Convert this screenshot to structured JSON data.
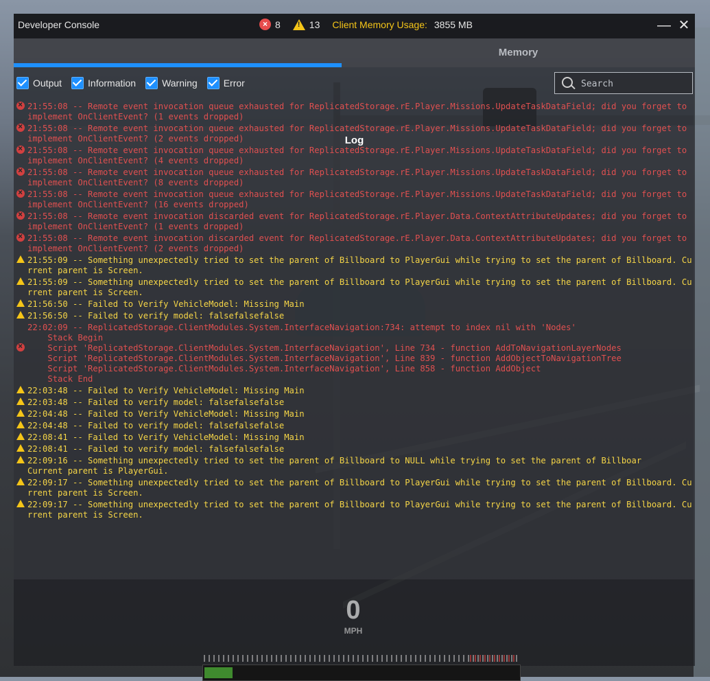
{
  "window": {
    "title": "Developer Console",
    "error_count": "8",
    "warning_count": "13",
    "memory_label": "Client Memory Usage:",
    "memory_value": "3855 MB",
    "minimize_glyph": "—",
    "close_glyph": "✕"
  },
  "tabs": [
    {
      "label": "Log",
      "active": true
    },
    {
      "label": "Memory",
      "active": false
    }
  ],
  "filters": [
    {
      "label": "Output",
      "checked": true
    },
    {
      "label": "Information",
      "checked": true
    },
    {
      "label": "Warning",
      "checked": true
    },
    {
      "label": "Error",
      "checked": true
    }
  ],
  "search": {
    "placeholder": "Search",
    "value": ""
  },
  "log": [
    {
      "type": "error",
      "text": "21:55:08 -- Remote event invocation queue exhausted for ReplicatedStorage.rE.Player.Missions.UpdateTaskDataField; did you forget to implement OnClientEvent? (1 events dropped)"
    },
    {
      "type": "error",
      "text": "21:55:08 -- Remote event invocation queue exhausted for ReplicatedStorage.rE.Player.Missions.UpdateTaskDataField; did you forget to implement OnClientEvent? (2 events dropped)"
    },
    {
      "type": "error",
      "text": "21:55:08 -- Remote event invocation queue exhausted for ReplicatedStorage.rE.Player.Missions.UpdateTaskDataField; did you forget to implement OnClientEvent? (4 events dropped)"
    },
    {
      "type": "error",
      "text": "21:55:08 -- Remote event invocation queue exhausted for ReplicatedStorage.rE.Player.Missions.UpdateTaskDataField; did you forget to implement OnClientEvent? (8 events dropped)"
    },
    {
      "type": "error",
      "text": "21:55:08 -- Remote event invocation queue exhausted for ReplicatedStorage.rE.Player.Missions.UpdateTaskDataField; did you forget to implement OnClientEvent? (16 events dropped)"
    },
    {
      "type": "error",
      "text": "21:55:08 -- Remote event invocation discarded event for ReplicatedStorage.rE.Player.Data.ContextAttributeUpdates; did you forget to implement OnClientEvent? (1 events dropped)"
    },
    {
      "type": "error",
      "text": "21:55:08 -- Remote event invocation discarded event for ReplicatedStorage.rE.Player.Data.ContextAttributeUpdates; did you forget to implement OnClientEvent? (2 events dropped)"
    },
    {
      "type": "warning",
      "text": "21:55:09 -- Something unexpectedly tried to set the parent of Billboard to PlayerGui while trying to set the parent of Billboard. Current parent is Screen."
    },
    {
      "type": "warning",
      "text": "21:55:09 -- Something unexpectedly tried to set the parent of Billboard to PlayerGui while trying to set the parent of Billboard. Current parent is Screen."
    },
    {
      "type": "warning",
      "text": "21:56:50 -- Failed to Verify VehicleModel: Missing Main"
    },
    {
      "type": "warning",
      "text": "21:56:50 -- Failed to verify model: falsefalsefalse"
    },
    {
      "type": "error",
      "multi": true,
      "text": "22:02:09 -- ReplicatedStorage.ClientModules.System.InterfaceNavigation:734: attempt to index nil with 'Nodes'\n    Stack Begin\n    Script 'ReplicatedStorage.ClientModules.System.InterfaceNavigation', Line 734 - function AddToNavigationLayerNodes\n    Script 'ReplicatedStorage.ClientModules.System.InterfaceNavigation', Line 839 - function AddObjectToNavigationTree\n    Script 'ReplicatedStorage.ClientModules.System.InterfaceNavigation', Line 858 - function AddObject\n    Stack End"
    },
    {
      "type": "warning",
      "text": "22:03:48 -- Failed to Verify VehicleModel: Missing Main"
    },
    {
      "type": "warning",
      "text": "22:03:48 -- Failed to verify model: falsefalsefalse"
    },
    {
      "type": "warning",
      "text": "22:04:48 -- Failed to Verify VehicleModel: Missing Main"
    },
    {
      "type": "warning",
      "text": "22:04:48 -- Failed to verify model: falsefalsefalse"
    },
    {
      "type": "warning",
      "text": "22:08:41 -- Failed to Verify VehicleModel: Missing Main"
    },
    {
      "type": "warning",
      "text": "22:08:41 -- Failed to verify model: falsefalsefalse"
    },
    {
      "type": "warning",
      "text": "22:09:16 -- Something unexpectedly tried to set the parent of Billboard to NULL while trying to set the parent of Billboar\nCurrent parent is PlayerGui."
    },
    {
      "type": "warning",
      "text": "22:09:17 -- Something unexpectedly tried to set the parent of Billboard to PlayerGui while trying to set the parent of Billboard. Current parent is Screen."
    },
    {
      "type": "warning",
      "text": "22:09:17 -- Something unexpectedly tried to set the parent of Billboard to PlayerGui while trying to set the parent of Billboard. Current parent is Screen."
    }
  ],
  "hud": {
    "speed": "0",
    "unit": "MPH",
    "throttle_fraction": 0.09
  },
  "colors": {
    "accent": "#1e90ff",
    "error": "#e05050",
    "warning": "#f5d547",
    "memory_label": "#f5c518"
  }
}
